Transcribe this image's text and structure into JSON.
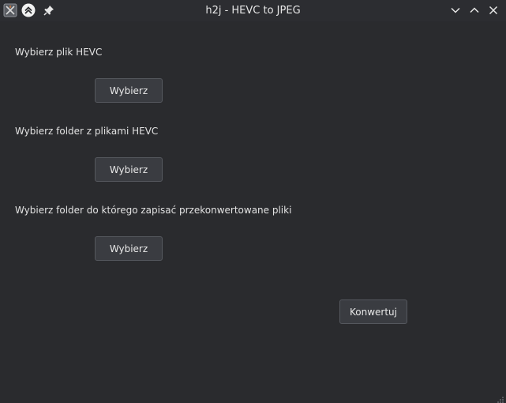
{
  "window": {
    "title": "h2j - HEVC to JPEG"
  },
  "icons": {
    "app": "app-logo-icon",
    "menu": "double-chevron-up-icon",
    "pin": "pin-icon",
    "minimize": "chevron-down-icon",
    "maximize": "chevron-up-icon",
    "close": "close-icon",
    "grip": "resize-grip-icon"
  },
  "form": {
    "file_label": "Wybierz plik HEVC",
    "file_button": "Wybierz",
    "folder_label": "Wybierz folder z plikami HEVC",
    "folder_button": "Wybierz",
    "output_label": "Wybierz folder do którego zapisać przekonwertowane pliki",
    "output_button": "Wybierz",
    "convert_button": "Konwertuj"
  },
  "colors": {
    "background": "#2a2b2e",
    "button": "#3a3c41",
    "text": "#e2e2e2"
  }
}
